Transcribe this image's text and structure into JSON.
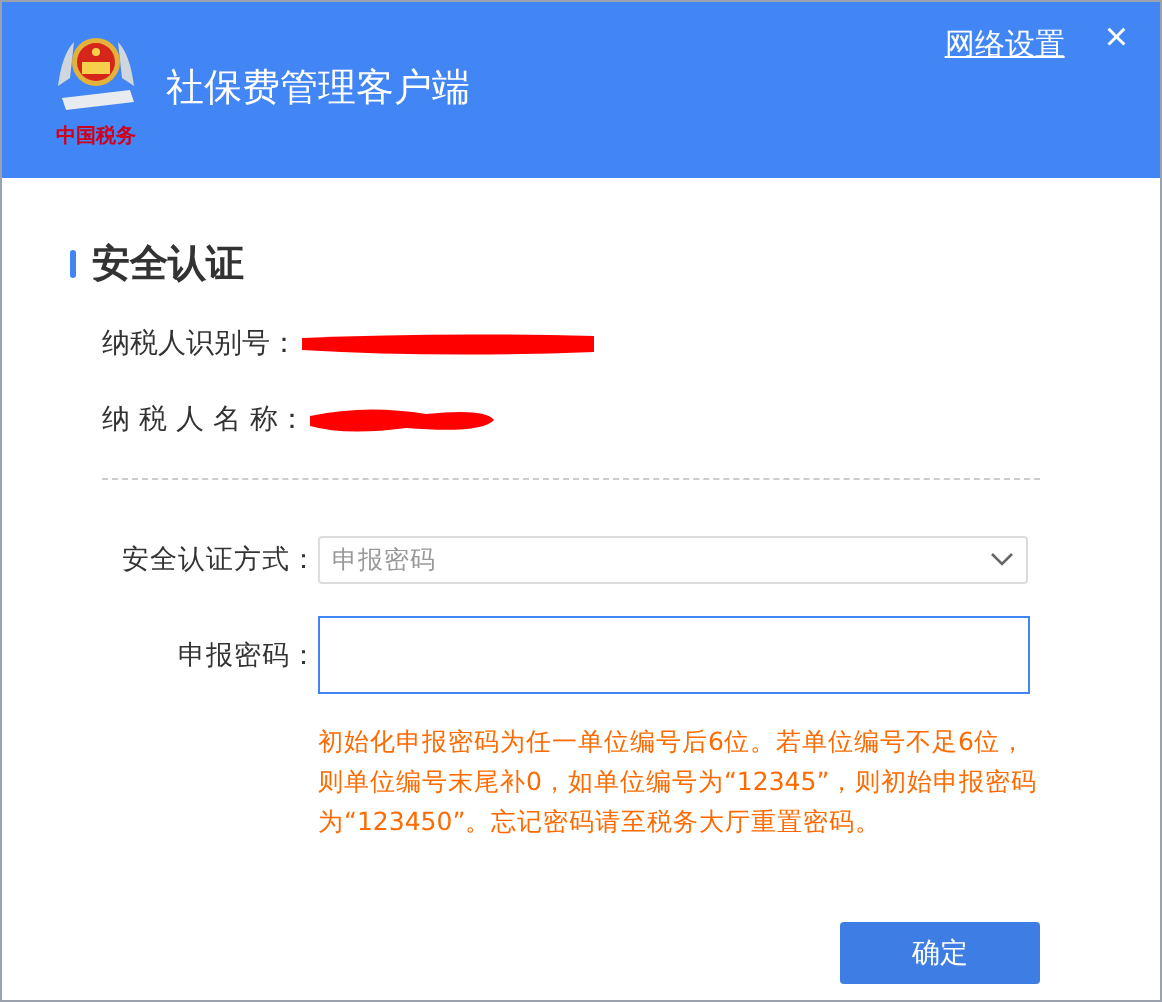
{
  "window": {
    "title": "社保费管理客户端",
    "logo_text": "中国税务",
    "network_link": "网络设置",
    "close": "×"
  },
  "section": {
    "title": "安全认证"
  },
  "info": [
    {
      "label": "纳税人识别号：",
      "redacted": true
    },
    {
      "label": "纳 税 人 名 称：",
      "redacted": true
    }
  ],
  "auth_method": {
    "label": "安全认证方式：",
    "placeholder": "申报密码"
  },
  "password": {
    "label": "申报密码：",
    "focused": true
  },
  "note": "初始化申报密码为任一单位编号后6位。若单位编号不足6位，则单位编号末尾补0，如单位编号为“12345”，则初始申报密码为“123450”。忘记密码请至税务大厅重置密码。",
  "buttons": [
    {
      "label": "确定"
    }
  ]
}
